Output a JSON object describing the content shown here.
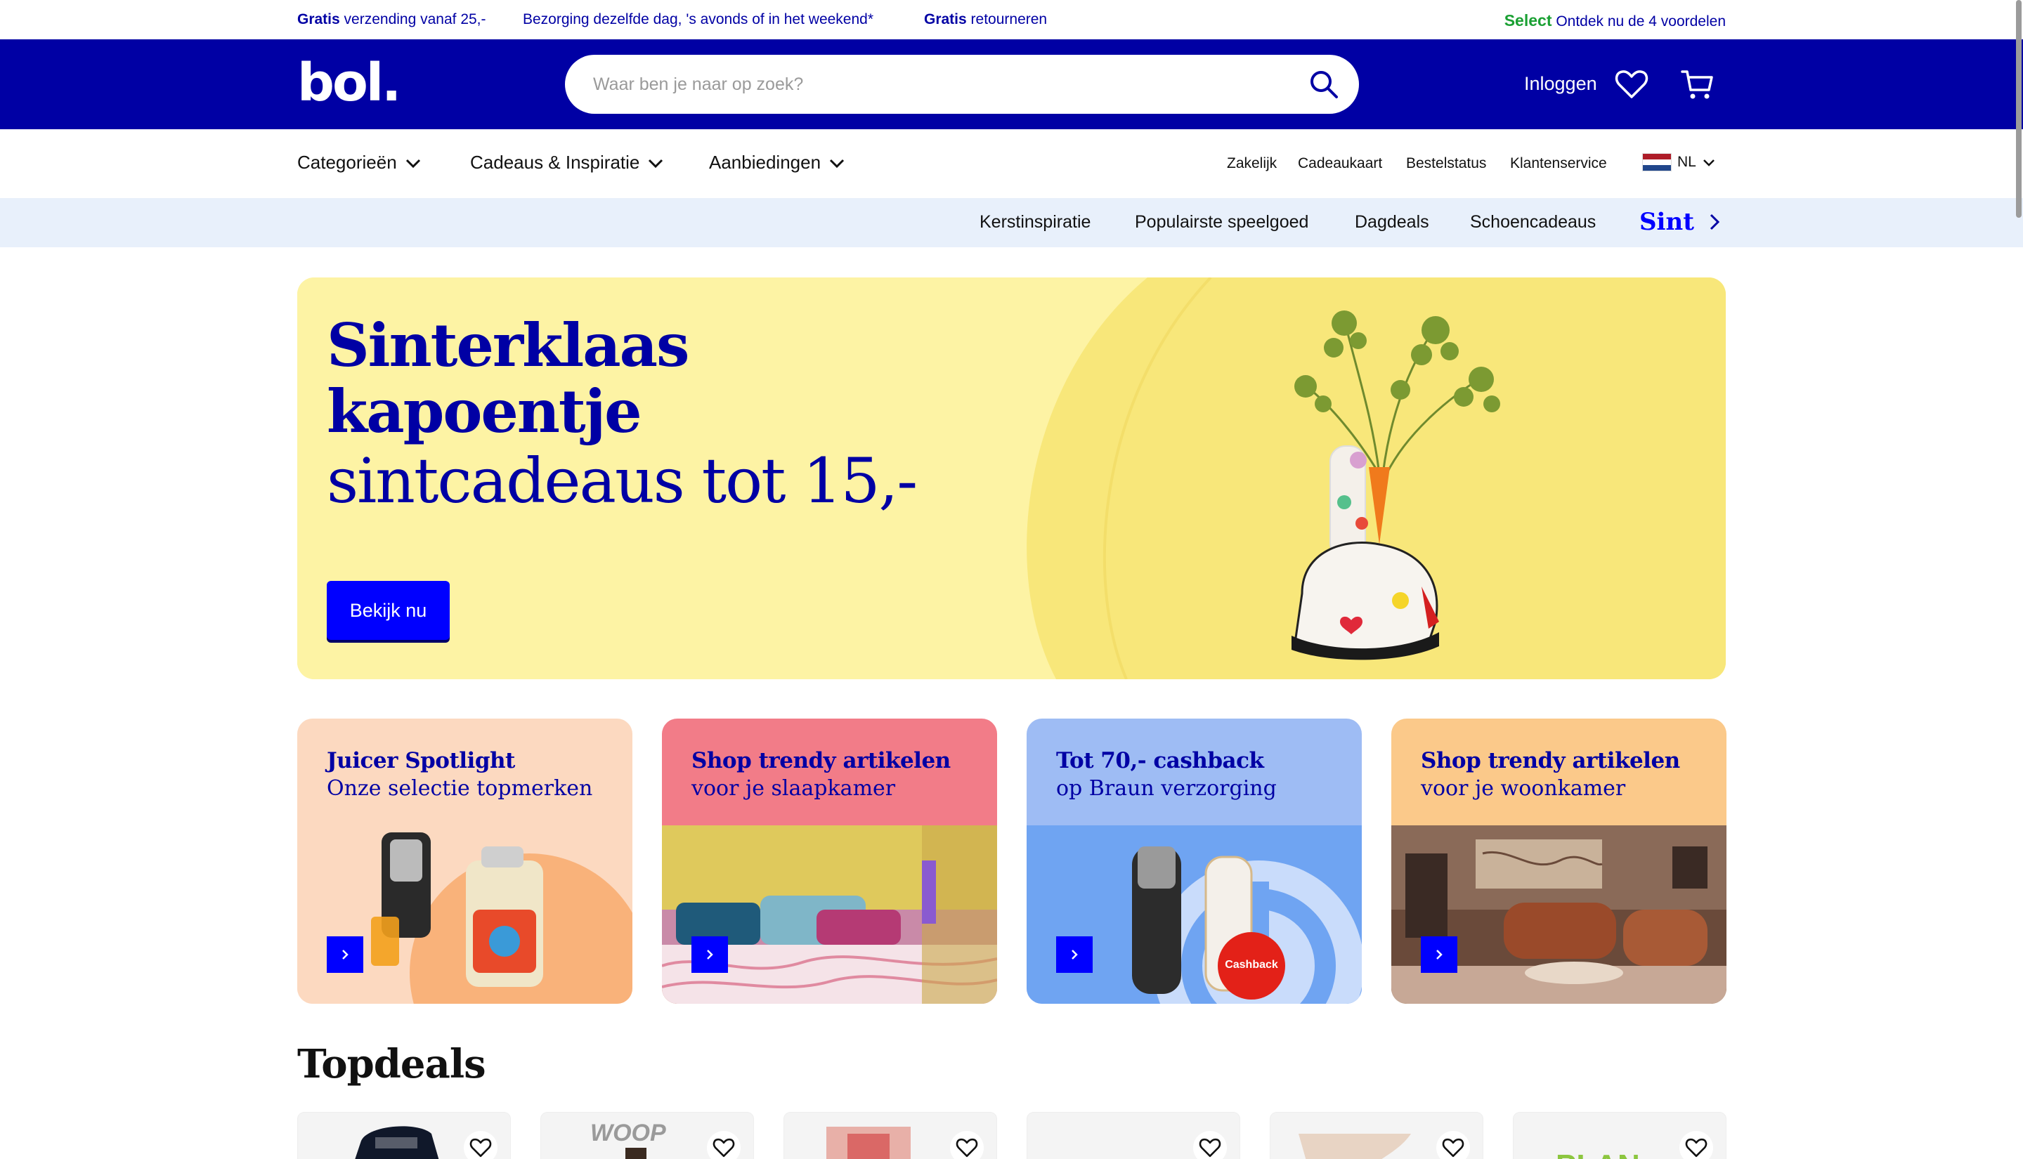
{
  "usp": {
    "item1_bold": "Gratis",
    "item1_text": " verzending vanaf 25,-",
    "item2_text": "Bezorging dezelfde dag, 's avonds of in het weekend*",
    "item3_bold": "Gratis",
    "item3_text": " retourneren",
    "select_brand": "Select",
    "select_text": " Ontdek nu de 4 voordelen"
  },
  "header": {
    "logo": "bol.",
    "search_placeholder": "Waar ben je naar op zoek?",
    "login_label": "Inloggen",
    "icons": [
      "search-icon",
      "heart-icon",
      "cart-icon"
    ]
  },
  "nav": {
    "categories": [
      {
        "label": "Categorieën"
      },
      {
        "label": "Cadeaus & Inspiratie"
      },
      {
        "label": "Aanbiedingen"
      }
    ],
    "utility": [
      "Zakelijk",
      "Cadeaukaart",
      "Bestelstatus",
      "Klantenservice"
    ],
    "language": "NL"
  },
  "inspiration": {
    "items": [
      "Kerstinspiratie",
      "Populairste speelgoed",
      "Dagdeals",
      "Schoencadeaus"
    ],
    "highlight": "Sint"
  },
  "hero": {
    "title_line1": "Sinterklaas",
    "title_line2": "kapoentje",
    "subtitle": "sintcadeaus tot 15,-",
    "cta": "Bekijk nu"
  },
  "cards": [
    {
      "title": "Juicer Spotlight",
      "subtitle": "Onze selectie topmerken",
      "color": "#fcd9c0"
    },
    {
      "title": "Shop trendy artikelen",
      "subtitle": "voor je slaapkamer",
      "color": "#f27c88"
    },
    {
      "title": "Tot 70,- cashback",
      "subtitle": "op Braun verzorging",
      "color": "#9ebcf4",
      "badge": "Cashback"
    },
    {
      "title": "Shop trendy artikelen",
      "subtitle": "voor je woonkamer",
      "color": "#fbc98a"
    }
  ],
  "topdeals": {
    "title": "Topdeals",
    "count": 6
  },
  "colors": {
    "brand_blue": "#0000a4",
    "cta_blue": "#0000ff",
    "select_green": "#1aa033",
    "hero_yellow": "#fdf3a4"
  }
}
